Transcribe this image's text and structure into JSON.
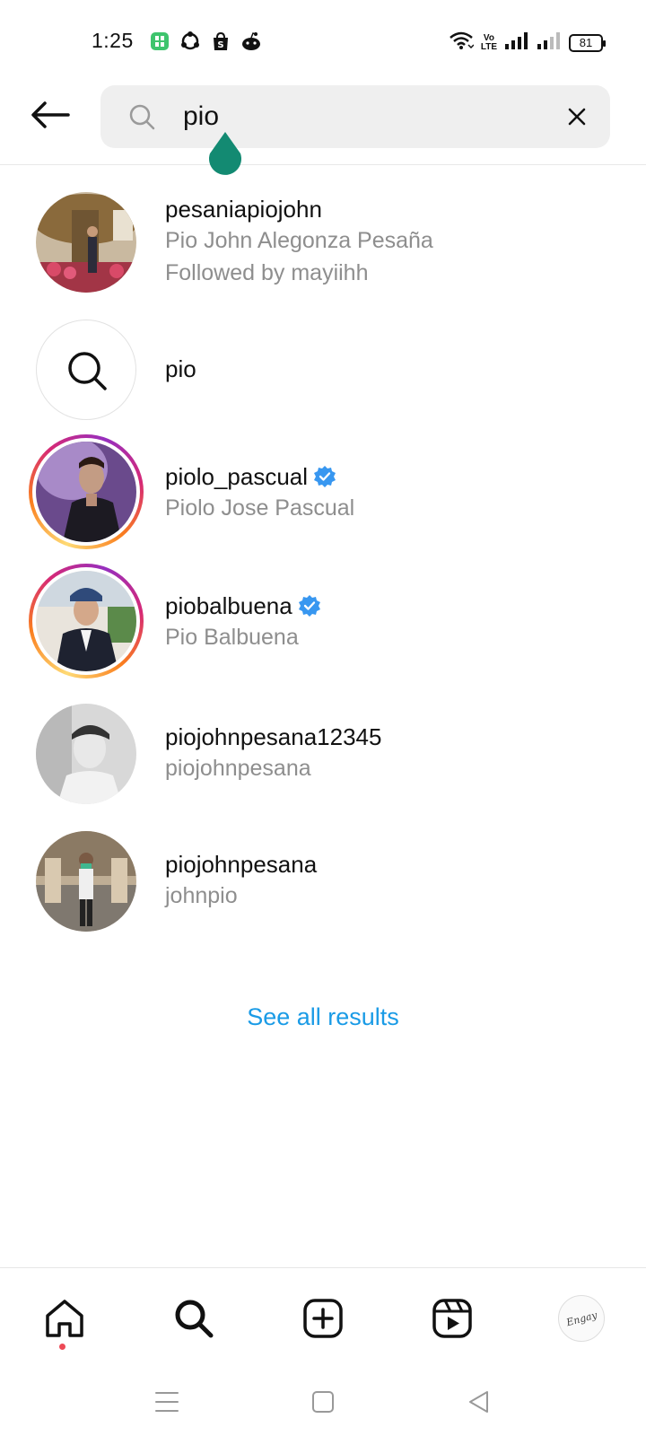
{
  "status_bar": {
    "time": "1:25",
    "volte_line1": "Vo",
    "volte_line2": "LTE",
    "battery": "81"
  },
  "search": {
    "query": "pio",
    "placeholder": "Search"
  },
  "results": [
    {
      "username": "pesaniapiojohn",
      "fullname": "Pio John Alegonza Pesaña",
      "followed_by": "Followed by mayiihh",
      "verified": false,
      "story_ring": false
    },
    {
      "type": "keyword",
      "query": "pio"
    },
    {
      "username": "piolo_pascual",
      "fullname": "Piolo Jose Pascual",
      "verified": true,
      "story_ring": true
    },
    {
      "username": "piobalbuena",
      "fullname": "Pio Balbuena",
      "verified": true,
      "story_ring": true
    },
    {
      "username": "piojohnpesana12345",
      "fullname": "piojohnpesana",
      "verified": false,
      "story_ring": false
    },
    {
      "username": "piojohnpesana",
      "fullname": "johnpio",
      "verified": false,
      "story_ring": false
    }
  ],
  "see_all_label": "See all results",
  "profile_logo_text": "Engay",
  "colors": {
    "link_blue": "#1a9be6",
    "verified_blue": "#3897f0",
    "muted_text": "#8e8e8e",
    "cursor_handle": "#138a72",
    "notification_red": "#ed4956"
  },
  "icons": {
    "back": "arrow-left-icon",
    "search": "search-icon",
    "clear": "close-icon",
    "home": "home-icon",
    "explore": "search-icon",
    "create": "plus-square-icon",
    "reels": "reels-icon"
  }
}
